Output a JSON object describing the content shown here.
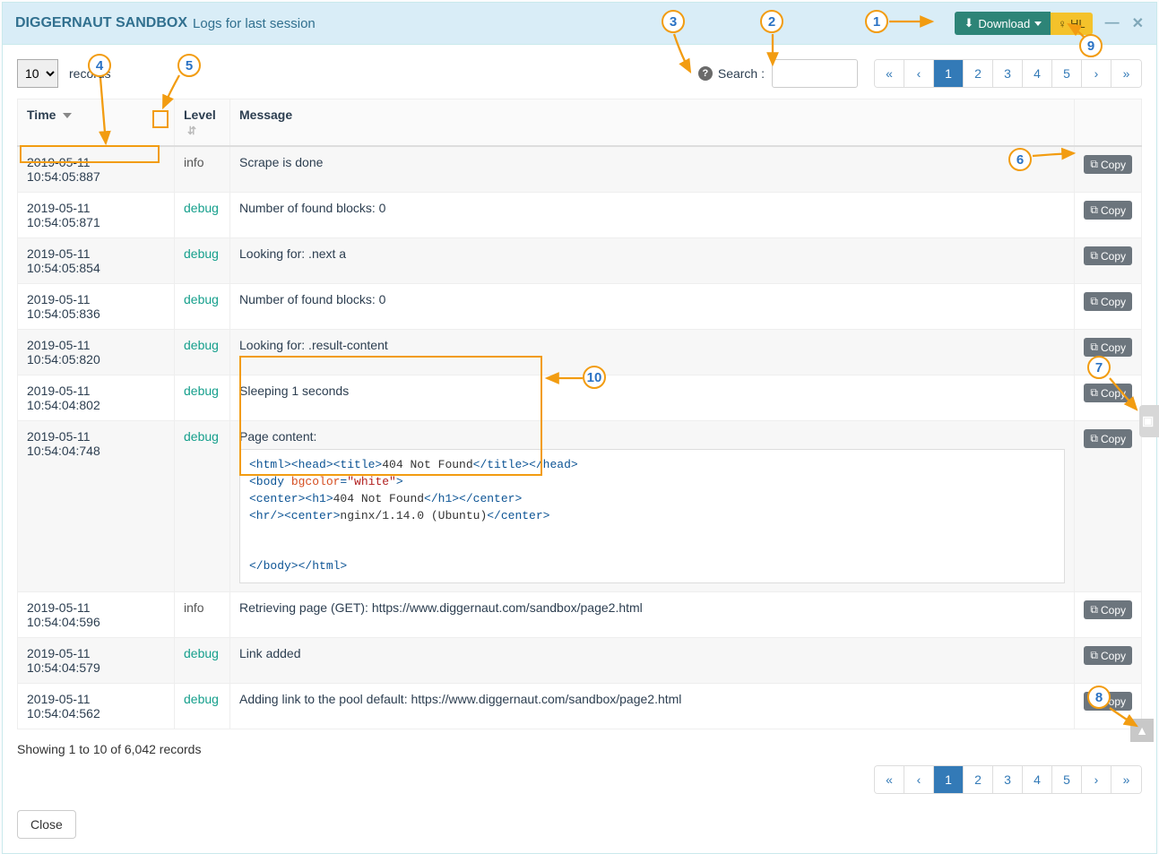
{
  "header": {
    "title": "DIGGERNAUT SANDBOX",
    "subtitle": "Logs for last session",
    "download_label": "Download",
    "hl_label": "HL"
  },
  "toolbar": {
    "records_select_value": "10",
    "records_label": "records",
    "search_label": "Search :",
    "search_value": ""
  },
  "pagination": {
    "pages": [
      "1",
      "2",
      "3",
      "4",
      "5"
    ],
    "active": "1"
  },
  "table": {
    "columns": {
      "time": "Time",
      "level": "Level",
      "message": "Message"
    },
    "copy_label": "Copy",
    "rows": [
      {
        "time": "2019-05-11 10:54:05:887",
        "level": "info",
        "msg": "Scrape is done"
      },
      {
        "time": "2019-05-11 10:54:05:871",
        "level": "debug",
        "msg": "Number of found blocks: 0"
      },
      {
        "time": "2019-05-11 10:54:05:854",
        "level": "debug",
        "msg": "Looking for: .next a"
      },
      {
        "time": "2019-05-11 10:54:05:836",
        "level": "debug",
        "msg": "Number of found blocks: 0"
      },
      {
        "time": "2019-05-11 10:54:05:820",
        "level": "debug",
        "msg": "Looking for: .result-content"
      },
      {
        "time": "2019-05-11 10:54:04:802",
        "level": "debug",
        "msg": "Sleeping 1 seconds"
      },
      {
        "time": "2019-05-11 10:54:04:748",
        "level": "debug",
        "msg": "Page content:",
        "code": true
      },
      {
        "time": "2019-05-11 10:54:04:596",
        "level": "info",
        "msg": "Retrieving page (GET): https://www.diggernaut.com/sandbox/page2.html"
      },
      {
        "time": "2019-05-11 10:54:04:579",
        "level": "debug",
        "msg": "Link added"
      },
      {
        "time": "2019-05-11 10:54:04:562",
        "level": "debug",
        "msg": "Adding link to the pool default: https://www.diggernaut.com/sandbox/page2.html"
      }
    ]
  },
  "code": {
    "l1a": "<html><head><title>",
    "l1b": "404 Not Found",
    "l1c": "</title></head>",
    "l2a": "<body ",
    "l2b": "bgcolor",
    "l2c": "=",
    "l2d": "\"white\"",
    "l2e": ">",
    "l3a": "<center><h1>",
    "l3b": "404 Not Found",
    "l3c": "</h1></center>",
    "l4a": "<hr/><center>",
    "l4b": "nginx/1.14.0 (Ubuntu)",
    "l4c": "</center>",
    "l5": "</body></html>"
  },
  "footer": {
    "info": "Showing 1 to 10 of 6,042 records",
    "close": "Close"
  },
  "annotations": {
    "n1": "1",
    "n2": "2",
    "n3": "3",
    "n4": "4",
    "n5": "5",
    "n6": "6",
    "n7": "7",
    "n8": "8",
    "n9": "9",
    "n10": "10"
  }
}
